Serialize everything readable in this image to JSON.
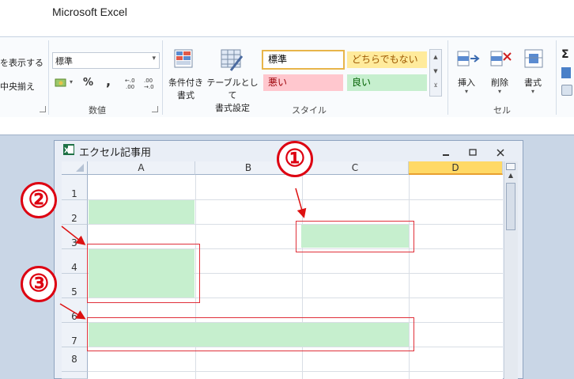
{
  "app": {
    "title": "Microsoft Excel"
  },
  "ribbon": {
    "left_labels": [
      "を表示する",
      "中央揃え"
    ],
    "number": {
      "format_value": "標準",
      "percent": "%",
      "comma": ",",
      "group_label": "数値"
    },
    "styles": {
      "conditional_format": [
        "条件付き",
        "書式"
      ],
      "table_format": [
        "テーブルとして",
        "書式設定"
      ],
      "cells": [
        {
          "label": "標準",
          "bg": "#ffffff",
          "color": "#000000"
        },
        {
          "label": "どちらでもない",
          "bg": "#ffeb9c",
          "color": "#9c5700"
        },
        {
          "label": "悪い",
          "bg": "#ffc7ce",
          "color": "#9c0006"
        },
        {
          "label": "良い",
          "bg": "#c6efce",
          "color": "#006100"
        }
      ],
      "group_label": "スタイル"
    },
    "cells_group": {
      "insert": "挿入",
      "delete": "削除",
      "format": "書式",
      "group_label": "セル"
    },
    "sigma": "Σ"
  },
  "workbook": {
    "title": "エクセル記事用",
    "columns": [
      "A",
      "B",
      "C",
      "D"
    ],
    "rows": [
      "1",
      "2",
      "3",
      "4",
      "5",
      "6",
      "7",
      "8"
    ],
    "selected_column": "D"
  },
  "annotations": [
    "①",
    "②",
    "③"
  ],
  "colors": {
    "good_fill": "#c6efce",
    "annotation_red": "#dd1111",
    "selected_col": "#ffd966"
  }
}
